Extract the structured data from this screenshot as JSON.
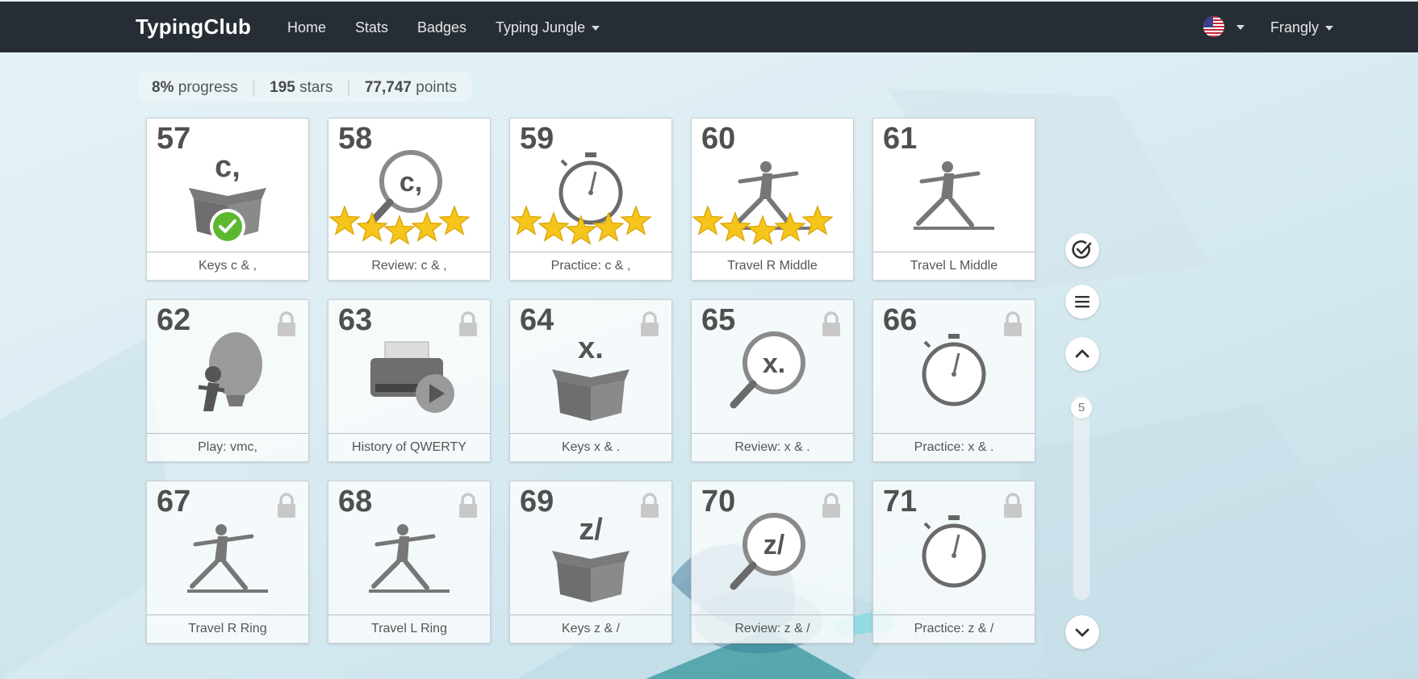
{
  "nav": {
    "brand": "TypingClub",
    "links": [
      "Home",
      "Stats",
      "Badges",
      "Typing Jungle"
    ],
    "user": "Frangly"
  },
  "stats": {
    "progress_value": "8%",
    "progress_label": "progress",
    "stars_value": "195",
    "stars_label": "stars",
    "points_value": "77,747",
    "points_label": "points"
  },
  "lessons": [
    {
      "num": "57",
      "label": "Keys c & ,",
      "icon": "box-icon",
      "glyph": "c,",
      "done": true
    },
    {
      "num": "58",
      "label": "Review: c & ,",
      "icon": "magnifier-icon",
      "glyph": "c,",
      "stars": 5
    },
    {
      "num": "59",
      "label": "Practice: c & ,",
      "icon": "stopwatch-icon",
      "stars": 5
    },
    {
      "num": "60",
      "label": "Travel R Middle",
      "icon": "stretch-figure-icon",
      "stars": 5
    },
    {
      "num": "61",
      "label": "Travel L Middle",
      "icon": "stretch-figure-icon"
    },
    {
      "num": "62",
      "label": "Play: vmc,",
      "icon": "balloon-game-icon",
      "locked": true
    },
    {
      "num": "63",
      "label": "History of QWERTY",
      "icon": "typewriter-video-icon",
      "locked": true
    },
    {
      "num": "64",
      "label": "Keys x & .",
      "icon": "box-icon",
      "glyph": "x.",
      "locked": true
    },
    {
      "num": "65",
      "label": "Review: x & .",
      "icon": "magnifier-icon",
      "glyph": "x.",
      "locked": true
    },
    {
      "num": "66",
      "label": "Practice: x & .",
      "icon": "stopwatch-icon",
      "locked": true
    },
    {
      "num": "67",
      "label": "Travel R Ring",
      "icon": "stretch-figure-icon",
      "locked": true
    },
    {
      "num": "68",
      "label": "Travel L Ring",
      "icon": "stretch-figure-icon",
      "locked": true
    },
    {
      "num": "69",
      "label": "Keys z & /",
      "icon": "box-icon",
      "glyph": "z/",
      "locked": true
    },
    {
      "num": "70",
      "label": "Review: z & /",
      "icon": "magnifier-icon",
      "glyph": "z/",
      "locked": true
    },
    {
      "num": "71",
      "label": "Practice: z & /",
      "icon": "stopwatch-icon",
      "locked": true
    }
  ],
  "sidebar_controls": {
    "icons": [
      "check-circle-icon",
      "menu-icon",
      "chevron-up-icon",
      "chevron-down-icon"
    ],
    "page": "5"
  }
}
